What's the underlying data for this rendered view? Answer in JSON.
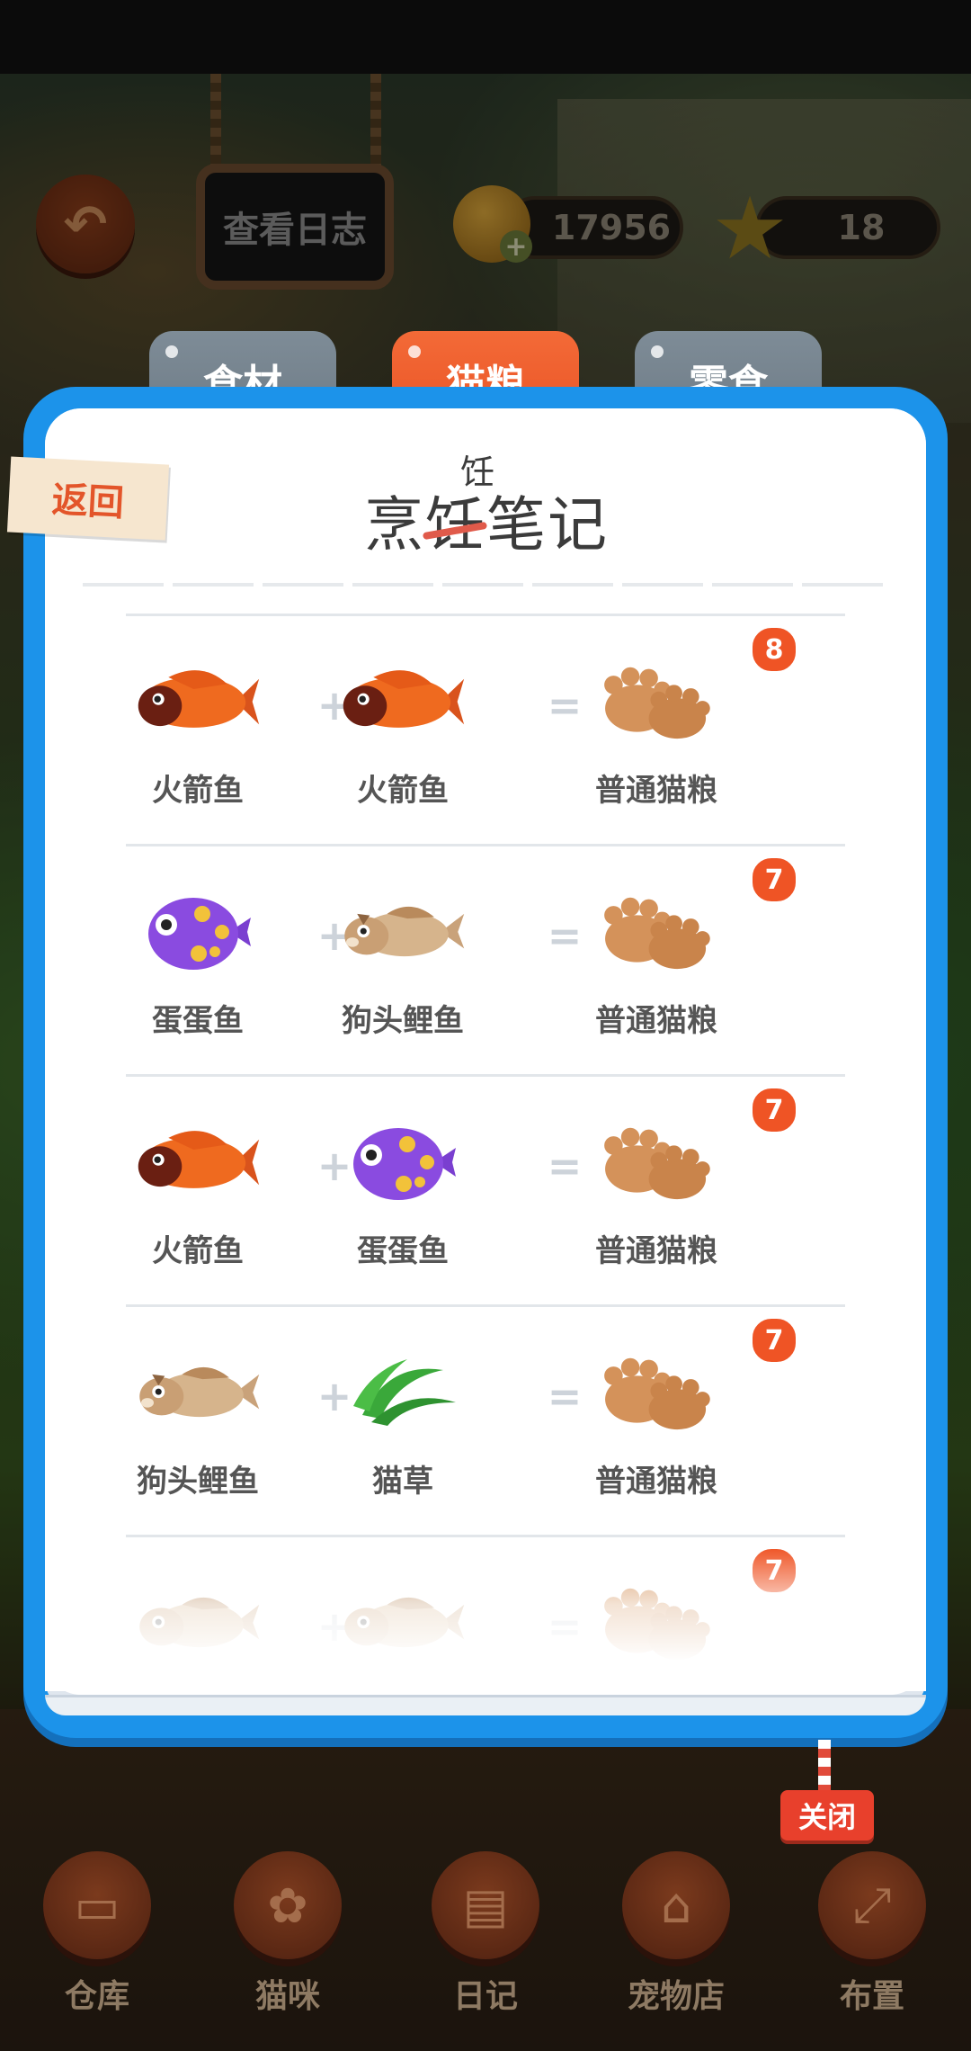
{
  "hud": {
    "log_label": "查看日志",
    "coins": "17956",
    "stars": "18"
  },
  "tabs": [
    {
      "label": "食材",
      "active": false
    },
    {
      "label": "猫粮",
      "active": true
    },
    {
      "label": "零食",
      "active": false
    }
  ],
  "notebook": {
    "title": "烹饪笔记",
    "title_correction": "饪",
    "back_label": "返回"
  },
  "recipes": [
    {
      "left": "火箭鱼",
      "left_icon": "rocket-fish-icon",
      "right": "火箭鱼",
      "right_icon": "rocket-fish-icon",
      "result": "普通猫粮",
      "result_icon": "paw-cookie-icon",
      "count": "8"
    },
    {
      "left": "蛋蛋鱼",
      "left_icon": "spotted-fish-icon",
      "right": "狗头鲤鱼",
      "right_icon": "dog-carp-icon",
      "result": "普通猫粮",
      "result_icon": "paw-cookie-icon",
      "count": "7"
    },
    {
      "left": "火箭鱼",
      "left_icon": "rocket-fish-icon",
      "right": "蛋蛋鱼",
      "right_icon": "spotted-fish-icon",
      "result": "普通猫粮",
      "result_icon": "paw-cookie-icon",
      "count": "7"
    },
    {
      "left": "狗头鲤鱼",
      "left_icon": "dog-carp-icon",
      "right": "猫草",
      "right_icon": "catgrass-icon",
      "result": "普通猫粮",
      "result_icon": "paw-cookie-icon",
      "count": "7"
    },
    {
      "left": "",
      "left_icon": "dog-carp-icon",
      "right": "",
      "right_icon": "dog-carp-icon",
      "result": "",
      "result_icon": "paw-cookie-icon",
      "count": "7"
    }
  ],
  "operators": {
    "plus": "+",
    "equals": "="
  },
  "close_label": "关闭",
  "bottom_nav": [
    {
      "label": "仓库",
      "icon": "box-icon"
    },
    {
      "label": "猫咪",
      "icon": "paw-icon"
    },
    {
      "label": "日记",
      "icon": "notebook-icon"
    },
    {
      "label": "宠物店",
      "icon": "shop-icon"
    },
    {
      "label": "布置",
      "icon": "expand-icon"
    }
  ],
  "colors": {
    "panel_blue": "#1c93ea",
    "active_tab": "#ea5426",
    "inactive_tab": "#6e7b86",
    "badge": "#ef5425"
  }
}
